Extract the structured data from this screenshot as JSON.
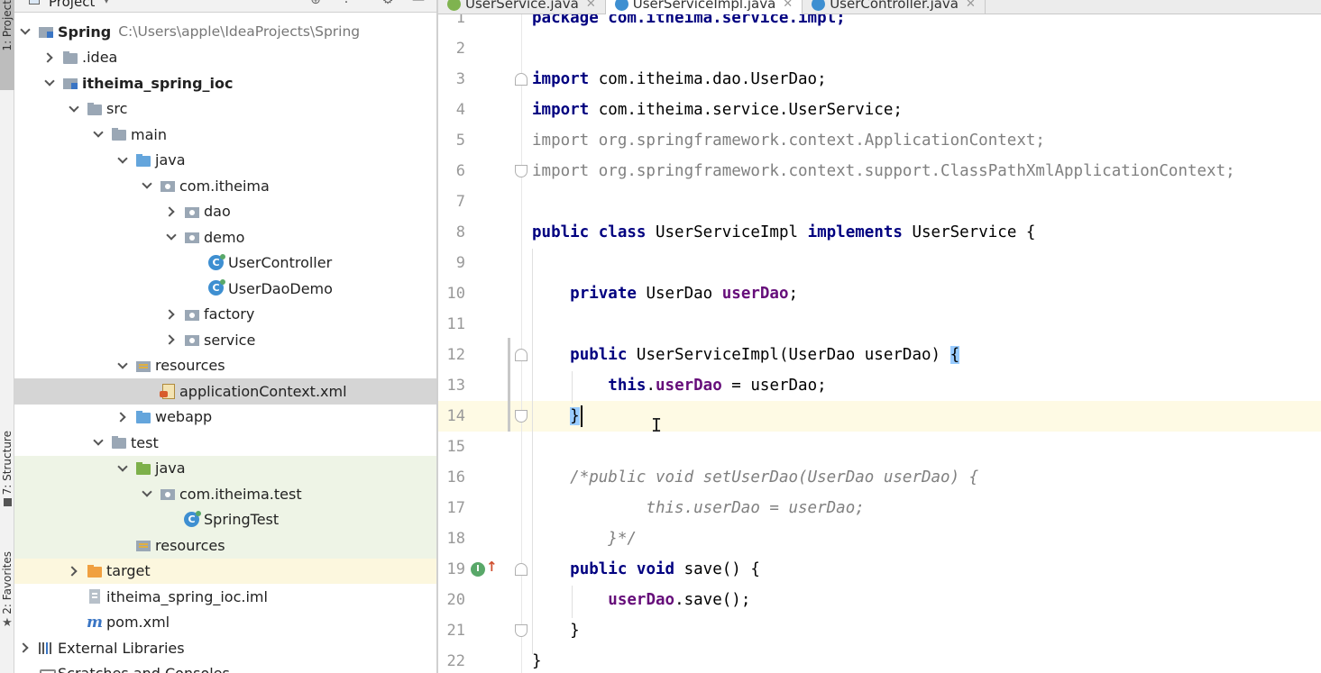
{
  "toolstrip": {
    "project_tab": "1: Project",
    "structure_tab": "7: Structure",
    "favorites_tab": "2: Favorites"
  },
  "project_panel": {
    "title": "Project"
  },
  "tree": [
    {
      "label": "Spring",
      "path": "C:\\Users\\apple\\IdeaProjects\\Spring",
      "icon": "module-icon"
    },
    {
      "label": ".idea",
      "icon": "folder-icon"
    },
    {
      "label": "itheima_spring_ioc",
      "icon": "module-icon"
    },
    {
      "label": "src",
      "icon": "folder-icon"
    },
    {
      "label": "main",
      "icon": "folder-icon"
    },
    {
      "label": "java",
      "icon": "source-folder-icon"
    },
    {
      "label": "com.itheima",
      "icon": "package-icon"
    },
    {
      "label": "dao",
      "icon": "package-icon"
    },
    {
      "label": "demo",
      "icon": "package-icon"
    },
    {
      "label": "UserController",
      "icon": "class-icon"
    },
    {
      "label": "UserDaoDemo",
      "icon": "class-icon"
    },
    {
      "label": "factory",
      "icon": "package-icon"
    },
    {
      "label": "service",
      "icon": "package-icon"
    },
    {
      "label": "resources",
      "icon": "resources-folder-icon"
    },
    {
      "label": "applicationContext.xml",
      "icon": "xml-file-icon"
    },
    {
      "label": "webapp",
      "icon": "web-folder-icon"
    },
    {
      "label": "test",
      "icon": "folder-icon"
    },
    {
      "label": "java",
      "icon": "test-source-folder-icon"
    },
    {
      "label": "com.itheima.test",
      "icon": "package-icon"
    },
    {
      "label": "SpringTest",
      "icon": "class-icon"
    },
    {
      "label": "resources",
      "icon": "test-resources-folder-icon"
    },
    {
      "label": "target",
      "icon": "excluded-folder-icon"
    },
    {
      "label": "itheima_spring_ioc.iml",
      "icon": "iml-file-icon"
    },
    {
      "label": "pom.xml",
      "icon": "maven-icon"
    },
    {
      "label": "External Libraries",
      "icon": "libraries-icon"
    },
    {
      "label": "Scratches and Consoles",
      "icon": "scratches-icon"
    }
  ],
  "tabs": [
    {
      "label": "UserService.java",
      "icon": "interface-icon",
      "active": false
    },
    {
      "label": "UserServiceImpl.java",
      "icon": "class-icon",
      "active": true
    },
    {
      "label": "UserController.java",
      "icon": "class-icon",
      "active": false
    }
  ],
  "editor": {
    "current_line": 14,
    "lines": [
      {
        "n": "1",
        "text": "package com.itheima.service.impl;"
      },
      {
        "n": "2",
        "text": ""
      },
      {
        "n": "3",
        "text": "import com.itheima.dao.UserDao;"
      },
      {
        "n": "4",
        "text": "import com.itheima.service.UserService;"
      },
      {
        "n": "5",
        "text": "import org.springframework.context.ApplicationContext;"
      },
      {
        "n": "6",
        "text": "import org.springframework.context.support.ClassPathXmlApplicationContext;"
      },
      {
        "n": "7",
        "text": ""
      },
      {
        "n": "8",
        "text": "public class UserServiceImpl implements UserService {"
      },
      {
        "n": "9",
        "text": ""
      },
      {
        "n": "10",
        "text": "private UserDao userDao;"
      },
      {
        "n": "11",
        "text": ""
      },
      {
        "n": "12",
        "text": "public UserServiceImpl(UserDao userDao) {"
      },
      {
        "n": "13",
        "text": "this.userDao = userDao;"
      },
      {
        "n": "14",
        "text": "}"
      },
      {
        "n": "15",
        "text": ""
      },
      {
        "n": "16",
        "text": "/*public void setUserDao(UserDao userDao) {"
      },
      {
        "n": "17",
        "text": "this.userDao = userDao;"
      },
      {
        "n": "18",
        "text": "}*/"
      },
      {
        "n": "19",
        "text": "public void save() {"
      },
      {
        "n": "20",
        "text": "userDao.save();"
      },
      {
        "n": "21",
        "text": "}"
      },
      {
        "n": "22",
        "text": "}"
      }
    ]
  },
  "colors": {
    "keyword": "#000080",
    "field": "#660e7a",
    "comment": "#808080",
    "selection": "#d5d5d5",
    "current_line": "#fefae4",
    "test_bg": "#eef4e6",
    "excluded_bg": "#fcf7de"
  }
}
